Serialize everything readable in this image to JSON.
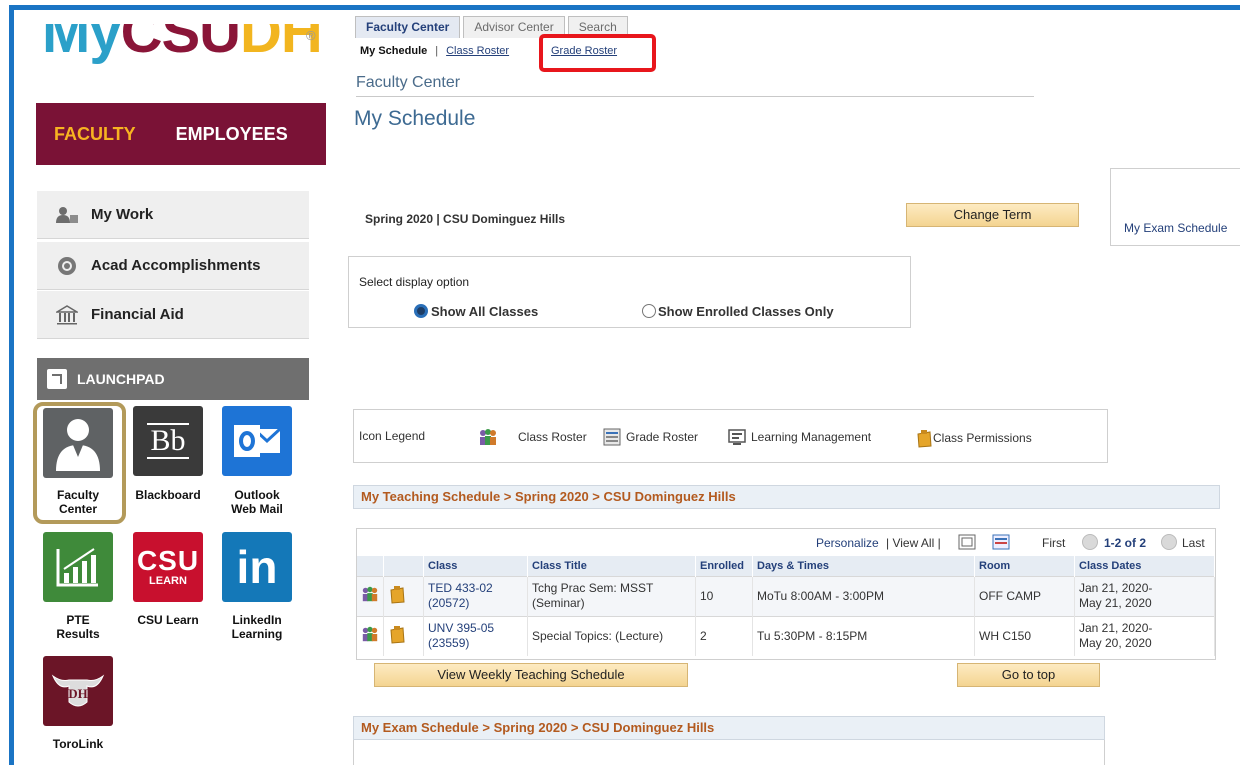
{
  "brand": {
    "my": "My",
    "csu": "CSU",
    "dh": "DH",
    "mark": "®"
  },
  "roles": {
    "faculty": "FACULTY",
    "employees": "EMPLOYEES"
  },
  "nav": [
    {
      "label": "My Work",
      "icon": "person-icon"
    },
    {
      "label": "Acad Accomplishments",
      "icon": "badge-icon"
    },
    {
      "label": "Financial Aid",
      "icon": "bank-icon"
    }
  ],
  "launchpad": {
    "title": "LAUNCHPAD",
    "tiles": [
      {
        "label": "Faculty Center",
        "l1": "Faculty",
        "l2": "Center",
        "icon": "faculty-person-icon",
        "color": "#5f6264"
      },
      {
        "label": "Blackboard",
        "l1": "Blackboard",
        "l2": "",
        "icon": "blackboard-icon",
        "glyph": "Bb",
        "color": "#3a3a3a"
      },
      {
        "label": "Outlook Web Mail",
        "l1": "Outlook",
        "l2": "Web Mail",
        "icon": "outlook-icon",
        "color": "#1e74d6"
      },
      {
        "label": "PTE Results",
        "l1": "PTE",
        "l2": "Results",
        "icon": "chart-icon",
        "color": "#3f8a3a"
      },
      {
        "label": "CSU Learn",
        "l1": "CSU Learn",
        "l2": "",
        "icon": "csu-learn-icon",
        "glyph_top": "CSU",
        "glyph_bottom": "LEARN",
        "color": "#c8102e"
      },
      {
        "label": "LinkedIn Learning",
        "l1": "LinkedIn",
        "l2": "Learning",
        "icon": "linkedin-icon",
        "glyph": "in",
        "color": "#1478b8"
      },
      {
        "label": "ToroLink",
        "l1": "ToroLink",
        "l2": "",
        "icon": "toro-icon",
        "glyph": "DH",
        "color": "#6b1527"
      }
    ]
  },
  "tabs": [
    {
      "label": "Faculty Center",
      "active": true
    },
    {
      "label": "Advisor Center",
      "active": false
    },
    {
      "label": "Search",
      "active": false
    }
  ],
  "subtabs": {
    "current": "My Schedule",
    "roster": "Class Roster",
    "grade": "Grade Roster"
  },
  "section_title": "Faculty Center",
  "page_title": "My Schedule",
  "term": {
    "text": "Spring 2020 | CSU Dominguez Hills",
    "change_button": "Change Term",
    "exam_link": "My Exam Schedule"
  },
  "display": {
    "label": "Select display option",
    "options": [
      {
        "label": "Show All Classes",
        "selected": true
      },
      {
        "label": "Show Enrolled Classes Only",
        "selected": false
      }
    ]
  },
  "legend": {
    "label": "Icon Legend",
    "items": [
      "Class Roster",
      "Grade Roster",
      "Learning Management",
      "Class Permissions"
    ]
  },
  "teaching": {
    "header": "My Teaching Schedule > Spring 2020 > CSU Dominguez Hills",
    "nav": {
      "personalize": "Personalize",
      "view_all": "| View All |",
      "first": "First",
      "count": "1-2 of 2",
      "last": "Last"
    },
    "columns": [
      "Class",
      "Class Title",
      "Enrolled",
      "Days & Times",
      "Room",
      "Class Dates"
    ],
    "rows": [
      {
        "class1": "TED 433-02",
        "class2": "(20572)",
        "title1": "Tchg Prac Sem: MSST",
        "title2": "(Seminar)",
        "enrolled": "10",
        "days": "MoTu 8:00AM - 3:00PM",
        "room": "OFF CAMP",
        "dates1": "Jan 21, 2020-",
        "dates2": "May 21, 2020"
      },
      {
        "class1": "UNV 395-05",
        "class2": "(23559)",
        "title1": "Special Topics: (Lecture)",
        "title2": "",
        "enrolled": "2",
        "days": "Tu 5:30PM - 8:15PM",
        "room": "WH C150",
        "dates1": "Jan 21, 2020-",
        "dates2": "May 20, 2020"
      }
    ],
    "weekly_button": "View Weekly Teaching Schedule",
    "top_button": "Go to top"
  },
  "exam": {
    "header": "My Exam Schedule > Spring 2020 > CSU Dominguez Hills"
  },
  "colors": {
    "accent_blue": "#1a74c4",
    "maroon": "#7a1236",
    "gold": "#f7b321",
    "highlight_red": "#e8161c"
  }
}
